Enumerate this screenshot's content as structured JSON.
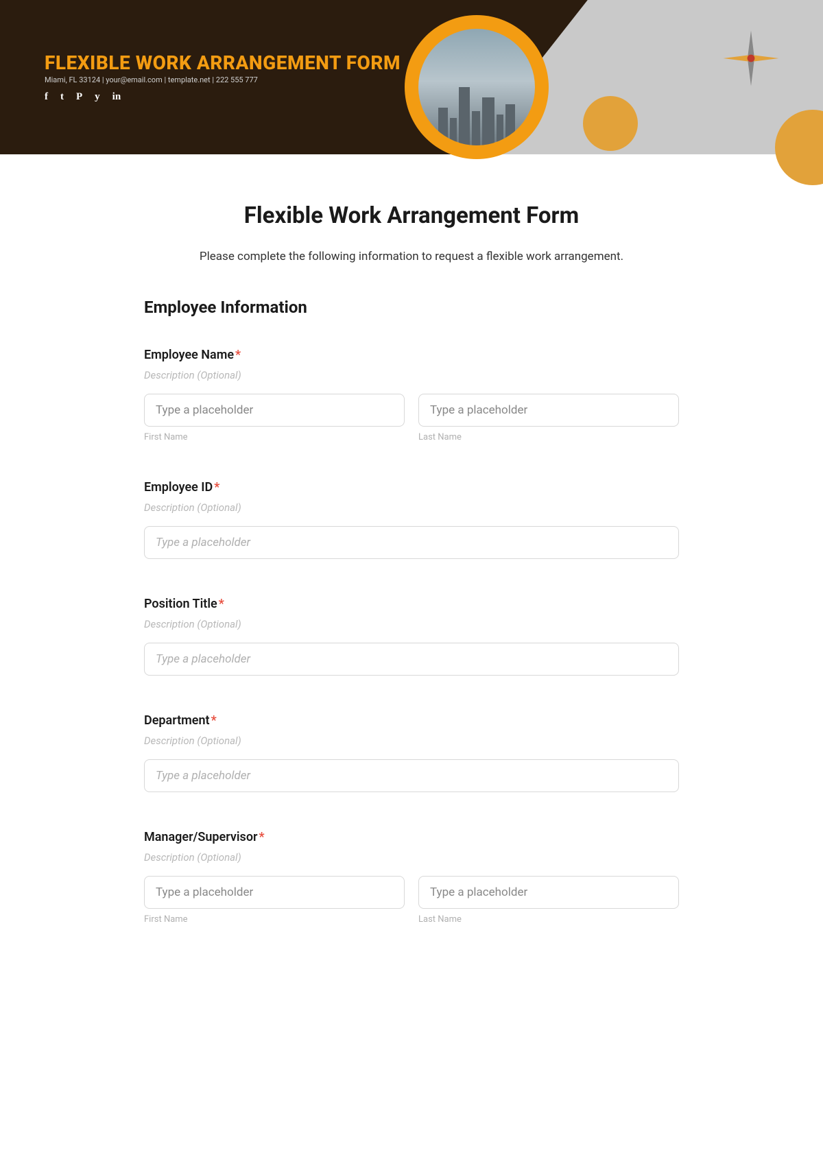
{
  "banner": {
    "title": "FLEXIBLE WORK ARRANGEMENT FORM",
    "subtitle": "Miami, FL 33124 | your@email.com | template.net | 222 555 777",
    "social": {
      "facebook": "f",
      "tumblr": "t",
      "pinterest": "P",
      "twitter": "y",
      "linkedin": "in"
    }
  },
  "page": {
    "title": "Flexible Work Arrangement Form",
    "intro": "Please complete the following information to request a flexible work arrangement."
  },
  "section": {
    "title": "Employee Information"
  },
  "fields": {
    "employee_name": {
      "label": "Employee Name",
      "desc": "Description (Optional)",
      "first_ph": "Type a placeholder",
      "last_ph": "Type a placeholder",
      "first_sub": "First Name",
      "last_sub": "Last Name"
    },
    "employee_id": {
      "label": "Employee ID",
      "desc": "Description (Optional)",
      "ph": "Type a placeholder"
    },
    "position": {
      "label": "Position Title",
      "desc": "Description (Optional)",
      "ph": "Type a placeholder"
    },
    "department": {
      "label": "Department",
      "desc": "Description (Optional)",
      "ph": "Type a placeholder"
    },
    "manager": {
      "label": "Manager/Supervisor",
      "desc": "Description (Optional)",
      "first_ph": "Type a placeholder",
      "last_ph": "Type a placeholder",
      "first_sub": "First Name",
      "last_sub": "Last Name"
    }
  },
  "required_marker": "*"
}
